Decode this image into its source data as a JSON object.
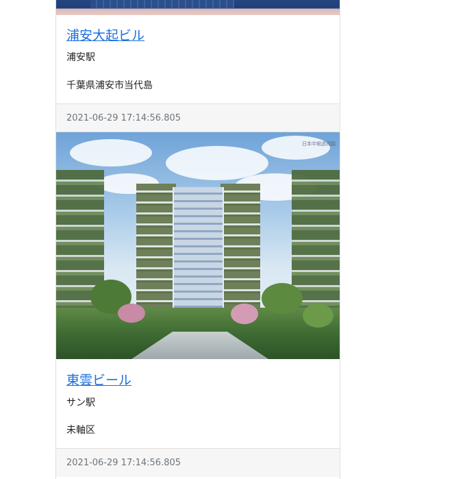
{
  "cards": [
    {
      "title": "浦安大起ビル",
      "station": "浦安駅",
      "address": "千葉県浦安市当代島",
      "timestamp": "2021-06-29 17:14:56.805"
    },
    {
      "title": "東雲ビール",
      "station": "サン駅",
      "address": "未軸区",
      "timestamp": "2021-06-29 17:14:56.805",
      "image_watermark": "日本中堀透視図"
    }
  ]
}
